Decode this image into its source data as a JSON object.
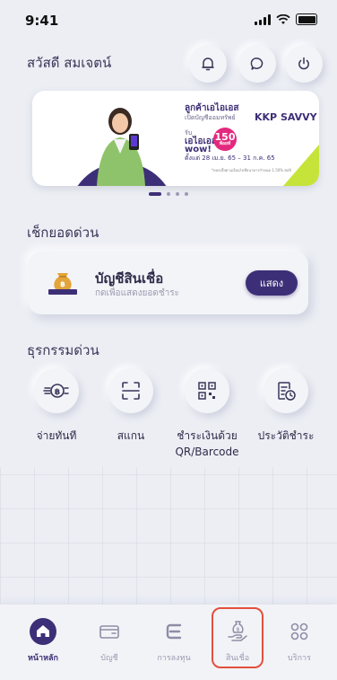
{
  "status_bar": {
    "time": "9:41"
  },
  "header": {
    "greeting": "สวัสดี สมเจตน์",
    "icons": [
      "bell-icon",
      "chat-icon",
      "power-icon"
    ]
  },
  "banner": {
    "title": "ลูกค้าเอไอเอส",
    "subtitle": "เปิดบัญชีออมทรัพย์",
    "brand": "KKP SAVVY",
    "small": "รับ",
    "wow": "เอไอเอส\nwow!",
    "badge_value": "150",
    "badge_unit": "พ้อยท์",
    "date": "ตั้งแต่ 28 เม.ย. 65 – 31 ก.ค. 65",
    "note": "*ดอกเบี้ยตามเงื่อนไขที่ธนาคารกำหนด 1.50% ต่อปี",
    "active_page": 1,
    "pages": 4
  },
  "quick_check": {
    "title": "เช็กยอดด่วน",
    "card_title": "บัญชีสินเชื่อ",
    "card_subtitle": "กดเพื่อแสดงยอดชำระ",
    "button": "แสดง"
  },
  "quick_actions": {
    "title": "ธุรกรรมด่วน",
    "items": [
      {
        "label": "จ่ายทันที",
        "icon": "baht-pay-icon"
      },
      {
        "label": "สแกน",
        "icon": "scan-icon"
      },
      {
        "label": "ชำระเงินด้วย\nQR/Barcode",
        "icon": "qr-code-icon"
      },
      {
        "label": "ประวัติชำระ",
        "icon": "history-icon"
      }
    ]
  },
  "tabbar": {
    "items": [
      {
        "label": "หน้าหลัก",
        "icon": "home-icon",
        "active": true
      },
      {
        "label": "บัญชี",
        "icon": "wallet-icon"
      },
      {
        "label": "การลงทุน",
        "icon": "investment-icon"
      },
      {
        "label": "สินเชื่อ",
        "icon": "loan-icon"
      },
      {
        "label": "บริการ",
        "icon": "services-icon"
      }
    ]
  },
  "colors": {
    "primary": "#3d2f77",
    "accent_lime": "#c6e33a",
    "badge_pink": "#e3297e",
    "highlight": "#e2503d"
  }
}
